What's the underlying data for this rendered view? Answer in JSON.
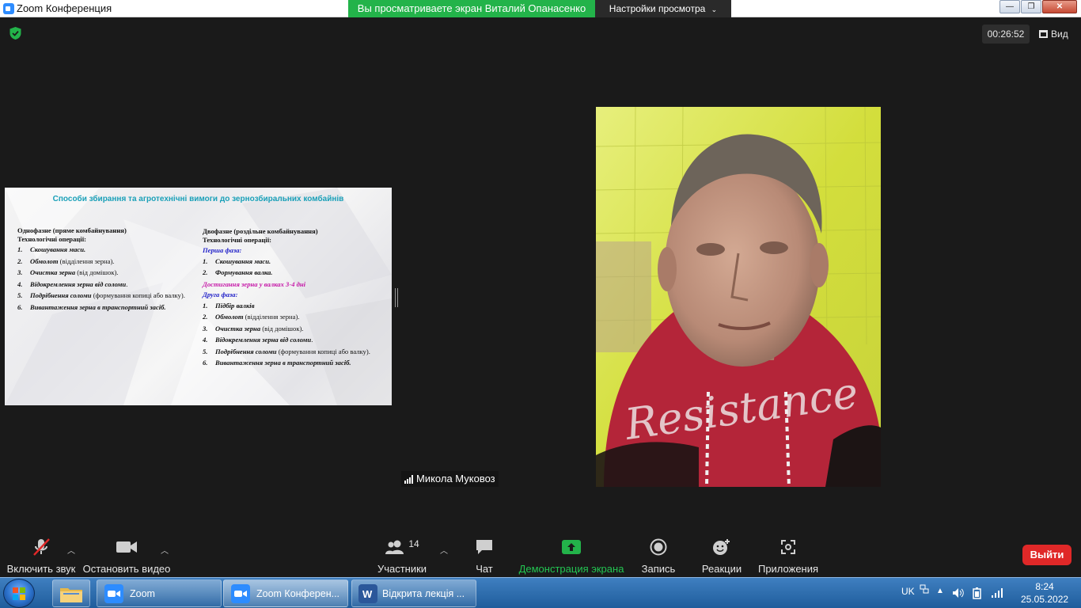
{
  "window": {
    "title": "Zoom Конференция",
    "sharing_banner": "Вы просматриваете экран Виталий Опанасенко",
    "view_options": "Настройки просмотра",
    "minimize": "—",
    "maximize": "❐",
    "close": "✕"
  },
  "meeting": {
    "elapsed": "00:26:52",
    "view_label": "Вид",
    "participant_name": "Микола Муковоз"
  },
  "slide": {
    "title": "Способи збирання та агротехнічні вимоги до зернозбиральних комбайнів",
    "left": {
      "heading": "Однофазне (пряме комбайнування)",
      "subheading": "Технологічні операції:",
      "items": [
        {
          "num": "1.",
          "bold": "Скошування маси.",
          "rest": ""
        },
        {
          "num": "2.",
          "bold": "Обмолот",
          "rest": " (відділення зерна)."
        },
        {
          "num": "3.",
          "bold": "Очистка зерна",
          "rest": " (від домішок)."
        },
        {
          "num": "4.",
          "bold": "Відокремлення зерна від соломи",
          "rest": "."
        },
        {
          "num": "5.",
          "bold": "Подрібнення соломи",
          "rest": " (формування копиці або валку)."
        },
        {
          "num": "6.",
          "bold": "Вивантаження зерна в транспортний засіб.",
          "rest": ""
        }
      ]
    },
    "right": {
      "heading": "Двофазне (роздільне комбайнування)",
      "subheading": "Технологічні операції:",
      "phase1": "Перша фаза:",
      "phase1_items": [
        {
          "num": "1.",
          "bold": "Скошування маси.",
          "rest": ""
        },
        {
          "num": "2.",
          "bold": "Формування валка.",
          "rest": ""
        }
      ],
      "transition": "Достигання зерна у валках 3-4 дні",
      "phase2": "Друга фаза:",
      "phase2_items": [
        {
          "num": "1.",
          "bold": "Підбір валків",
          "rest": ""
        },
        {
          "num": "2.",
          "bold": "Обмолот",
          "rest": " (відділення зерна)."
        },
        {
          "num": "3.",
          "bold": "Очистка зерна",
          "rest": " (від домішок)."
        },
        {
          "num": "4.",
          "bold": "Відокремлення зерна від соломи",
          "rest": "."
        },
        {
          "num": "5.",
          "bold": "Подрібнення соломи",
          "rest": " (формування копиці або валку)."
        },
        {
          "num": "6.",
          "bold": "Вивантаження зерна в транспортний засіб.",
          "rest": ""
        }
      ]
    }
  },
  "toolbar": {
    "audio": "Включить звук",
    "video": "Остановить видео",
    "participants": "Участники",
    "participants_count": "14",
    "chat": "Чат",
    "share": "Демонстрация экрана",
    "record": "Запись",
    "reactions": "Реакции",
    "apps": "Приложения",
    "leave": "Выйти"
  },
  "taskbar": {
    "items": [
      "Zoom",
      "Zoom Конферен...",
      "Відкрита лекція ..."
    ],
    "lang": "UK",
    "time": "8:24",
    "date": "25.05.2022"
  },
  "colors": {
    "share_green": "#23b34a",
    "leave_red": "#e02828",
    "slide_title": "#1aa0b8",
    "phase_blue": "#1e1ec8",
    "transition_magenta": "#c61aa8"
  }
}
